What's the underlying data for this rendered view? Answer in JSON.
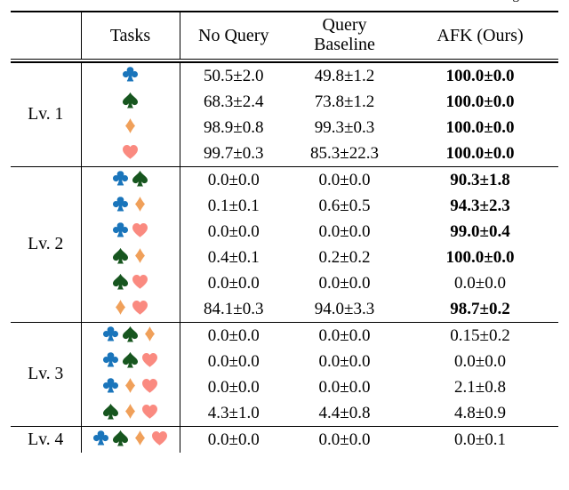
{
  "caption_fragment": "g",
  "colors": {
    "club": "#1a75bb",
    "spade": "#17561f",
    "diamond": "#f0a05a",
    "heart": "#fa8a80",
    "rule": "#000000",
    "text": "#000000"
  },
  "table": {
    "header": {
      "lv_col": "",
      "tasks": "Tasks",
      "no_query": "No Query",
      "query_baseline_line1": "Query",
      "query_baseline_line2": "Baseline",
      "afk": "AFK (Ours)"
    },
    "sections": [
      {
        "level_label": "Lv. 1",
        "rows": [
          {
            "suits": [
              "club"
            ],
            "no_query": "50.5±2.0",
            "query_baseline": "49.8±1.2",
            "afk": "100.0±0.0",
            "afk_bold": true
          },
          {
            "suits": [
              "spade"
            ],
            "no_query": "68.3±2.4",
            "query_baseline": "73.8±1.2",
            "afk": "100.0±0.0",
            "afk_bold": true
          },
          {
            "suits": [
              "diamond"
            ],
            "no_query": "98.9±0.8",
            "query_baseline": "99.3±0.3",
            "afk": "100.0±0.0",
            "afk_bold": true
          },
          {
            "suits": [
              "heart"
            ],
            "no_query": "99.7±0.3",
            "query_baseline": "85.3±22.3",
            "afk": "100.0±0.0",
            "afk_bold": true
          }
        ]
      },
      {
        "level_label": "Lv. 2",
        "rows": [
          {
            "suits": [
              "club",
              "spade"
            ],
            "no_query": "0.0±0.0",
            "query_baseline": "0.0±0.0",
            "afk": "90.3±1.8",
            "afk_bold": true
          },
          {
            "suits": [
              "club",
              "diamond"
            ],
            "no_query": "0.1±0.1",
            "query_baseline": "0.6±0.5",
            "afk": "94.3±2.3",
            "afk_bold": true
          },
          {
            "suits": [
              "club",
              "heart"
            ],
            "no_query": "0.0±0.0",
            "query_baseline": "0.0±0.0",
            "afk": "99.0±0.4",
            "afk_bold": true
          },
          {
            "suits": [
              "spade",
              "diamond"
            ],
            "no_query": "0.4±0.1",
            "query_baseline": "0.2±0.2",
            "afk": "100.0±0.0",
            "afk_bold": true
          },
          {
            "suits": [
              "spade",
              "heart"
            ],
            "no_query": "0.0±0.0",
            "query_baseline": "0.0±0.0",
            "afk": "0.0±0.0",
            "afk_bold": false
          },
          {
            "suits": [
              "diamond",
              "heart"
            ],
            "no_query": "84.1±0.3",
            "query_baseline": "94.0±3.3",
            "afk": "98.7±0.2",
            "afk_bold": true
          }
        ]
      },
      {
        "level_label": "Lv. 3",
        "rows": [
          {
            "suits": [
              "club",
              "spade",
              "diamond"
            ],
            "no_query": "0.0±0.0",
            "query_baseline": "0.0±0.0",
            "afk": "0.15±0.2",
            "afk_bold": false
          },
          {
            "suits": [
              "club",
              "spade",
              "heart"
            ],
            "no_query": "0.0±0.0",
            "query_baseline": "0.0±0.0",
            "afk": "0.0±0.0",
            "afk_bold": false
          },
          {
            "suits": [
              "club",
              "diamond",
              "heart"
            ],
            "no_query": "0.0±0.0",
            "query_baseline": "0.0±0.0",
            "afk": "2.1±0.8",
            "afk_bold": false
          },
          {
            "suits": [
              "spade",
              "diamond",
              "heart"
            ],
            "no_query": "4.3±1.0",
            "query_baseline": "4.4±0.8",
            "afk": "4.8±0.9",
            "afk_bold": false
          }
        ]
      },
      {
        "level_label": "Lv. 4",
        "rows": [
          {
            "suits": [
              "club",
              "spade",
              "diamond",
              "heart"
            ],
            "no_query": "0.0±0.0",
            "query_baseline": "0.0±0.0",
            "afk": "0.0±0.1",
            "afk_bold": false
          }
        ]
      }
    ]
  }
}
